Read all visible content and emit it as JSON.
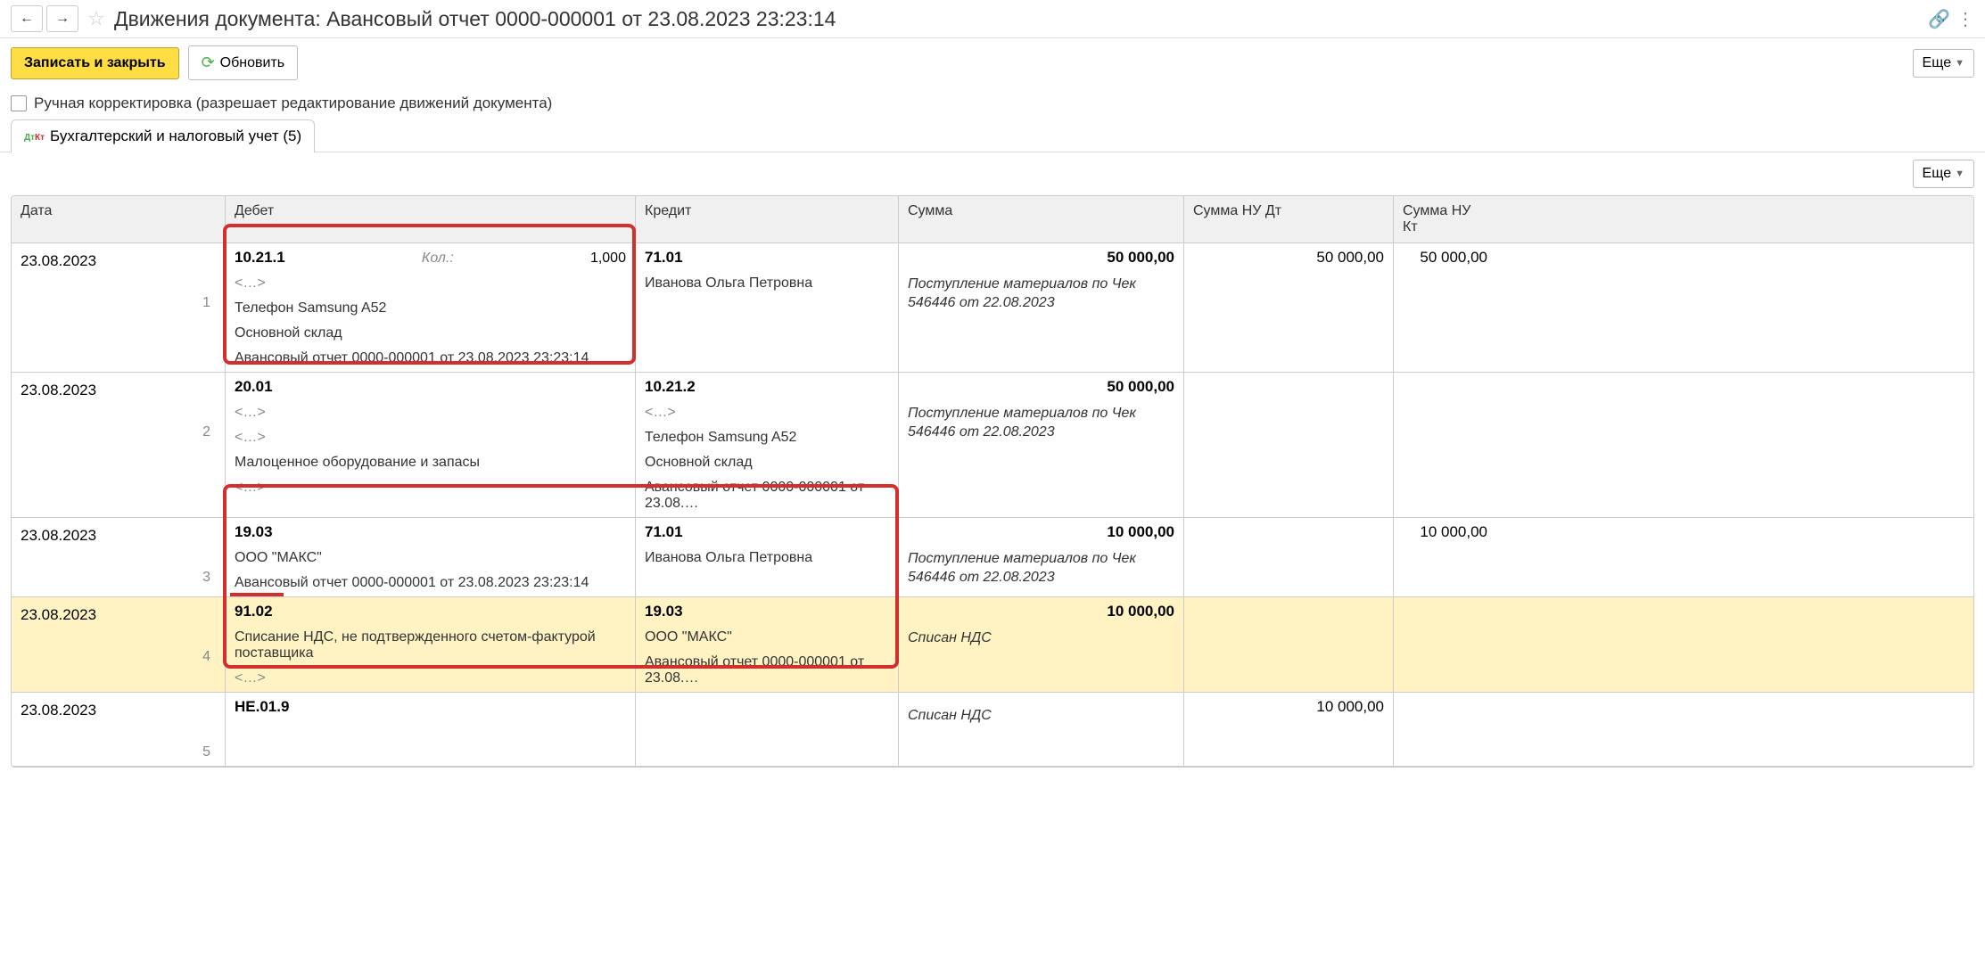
{
  "titlebar": {
    "title": "Движения документа: Авансовый отчет 0000-000001 от 23.08.2023 23:23:14"
  },
  "toolbar": {
    "save_close": "Записать и закрыть",
    "refresh": "Обновить",
    "more": "Еще"
  },
  "manual_edit": {
    "label": "Ручная корректировка (разрешает редактирование движений документа)"
  },
  "tabs": {
    "accounting": "Бухгалтерский и налоговый учет (5)"
  },
  "headers": {
    "date": "Дата",
    "debit": "Дебет",
    "credit": "Кредит",
    "sum": "Сумма",
    "sum_nu_dt": "Сумма НУ Дт",
    "sum_nu_kt": "Сумма НУ Кт"
  },
  "rows": [
    {
      "num": "1",
      "date": "23.08.2023",
      "debit": {
        "acct": "10.21.1",
        "qty_label": "Кол.:",
        "qty": "1,000",
        "subs": [
          "<…>",
          "Телефон Samsung A52",
          "Основной склад",
          "Авансовый отчет 0000-000001 от 23.08.2023 23:23:14"
        ]
      },
      "credit": {
        "acct": "71.01",
        "subs": [
          "Иванова Ольга Петровна"
        ]
      },
      "sum": "50 000,00",
      "sum_note": "Поступление материалов по Чек 546446 от 22.08.2023",
      "nu_dt": "50 000,00",
      "nu_kt": "50 000,00"
    },
    {
      "num": "2",
      "date": "23.08.2023",
      "debit": {
        "acct": "20.01",
        "subs": [
          "<…>",
          "<…>",
          "Малоценное оборудование и запасы",
          "<…>"
        ]
      },
      "credit": {
        "acct": "10.21.2",
        "subs": [
          "<…>",
          "Телефон Samsung A52",
          "Основной склад",
          "Авансовый отчет 0000-000001 от 23.08.…"
        ]
      },
      "sum": "50 000,00",
      "sum_note": "Поступление материалов по Чек 546446 от 22.08.2023",
      "nu_dt": "",
      "nu_kt": ""
    },
    {
      "num": "3",
      "date": "23.08.2023",
      "debit": {
        "acct": "19.03",
        "subs": [
          "ООО \"МАКС\"",
          "Авансовый отчет 0000-000001 от 23.08.2023 23:23:14"
        ]
      },
      "credit": {
        "acct": "71.01",
        "subs": [
          "Иванова Ольга Петровна"
        ]
      },
      "sum": "10 000,00",
      "sum_note": "Поступление материалов по Чек 546446 от 22.08.2023",
      "nu_dt": "",
      "nu_kt": "10 000,00"
    },
    {
      "num": "4",
      "date": "23.08.2023",
      "hl": true,
      "debit": {
        "acct": "91.02",
        "subs": [
          "Списание НДС, не подтвержденного счетом-фактурой поставщика",
          "<…>"
        ]
      },
      "credit": {
        "acct": "19.03",
        "subs": [
          "ООО \"МАКС\"",
          "Авансовый отчет 0000-000001 от 23.08.…"
        ]
      },
      "sum": "10 000,00",
      "sum_note": "Списан НДС",
      "nu_dt": "",
      "nu_kt": ""
    },
    {
      "num": "5",
      "date": "23.08.2023",
      "debit": {
        "acct": "НЕ.01.9",
        "subs": []
      },
      "credit": {
        "acct": "",
        "subs": []
      },
      "sum": "",
      "sum_note": "Списан НДС",
      "nu_dt": "10 000,00",
      "nu_kt": ""
    }
  ]
}
